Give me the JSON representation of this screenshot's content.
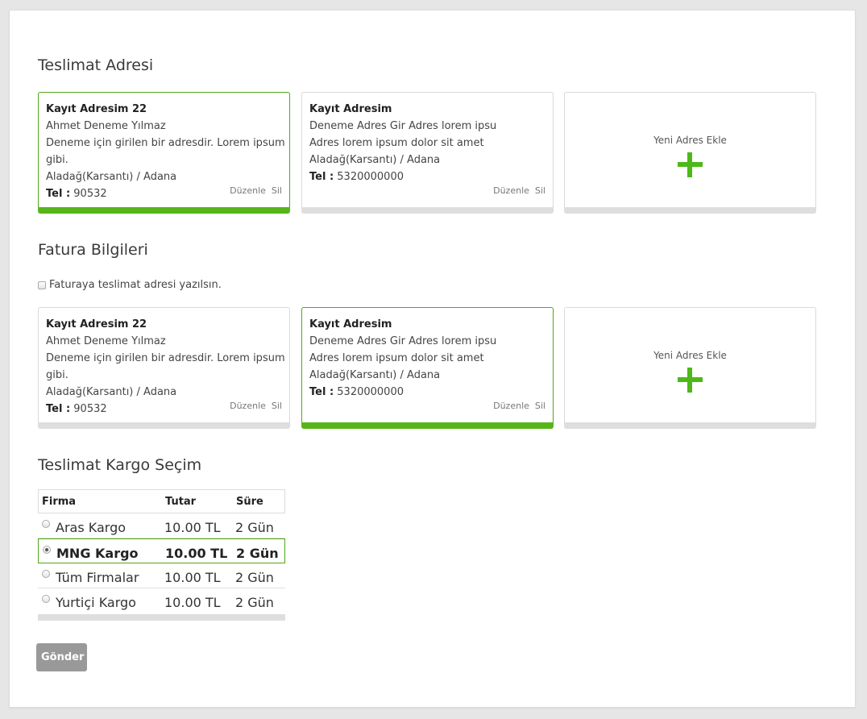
{
  "delivery": {
    "title": "Teslimat Adresi",
    "addresses": [
      {
        "name": "Kayıt Adresim 22",
        "person": "Ahmet Deneme Yılmaz",
        "line": "Deneme için girilen bir adresdir. Lorem ipsum gibi.",
        "city": "Aladağ(Karsantı) / Adana",
        "tel_label": "Tel :",
        "tel": " 90532",
        "edit": "Düzenle",
        "delete": "Sil",
        "selected": true
      },
      {
        "name": "Kayıt Adresim",
        "person": "Deneme Adres Gir Adres lorem ipsu",
        "line": "Adres lorem ipsum dolor sit amet",
        "city": "Aladağ(Karsantı) / Adana",
        "tel_label": "Tel :",
        "tel": " 5320000000",
        "edit": "Düzenle",
        "delete": "Sil",
        "selected": false
      }
    ],
    "add_label": "Yeni Adres Ekle"
  },
  "billing": {
    "title": "Fatura Bilgileri",
    "checkbox_label": "Faturaya teslimat adresi yazılsın.",
    "checkbox_checked": false,
    "addresses": [
      {
        "name": "Kayıt Adresim 22",
        "person": "Ahmet Deneme Yılmaz",
        "line": "Deneme için girilen bir adresdir. Lorem ipsum gibi.",
        "city": "Aladağ(Karsantı) / Adana",
        "tel_label": "Tel :",
        "tel": " 90532",
        "edit": "Düzenle",
        "delete": "Sil",
        "selected": false
      },
      {
        "name": "Kayıt Adresim",
        "person": "Deneme Adres Gir Adres lorem ipsu",
        "line": "Adres lorem ipsum dolor sit amet",
        "city": "Aladağ(Karsantı) / Adana",
        "tel_label": "Tel :",
        "tel": " 5320000000",
        "edit": "Düzenle",
        "delete": "Sil",
        "selected": true
      }
    ],
    "add_label": "Yeni Adres Ekle"
  },
  "cargo": {
    "title": "Teslimat Kargo Seçim",
    "columns": [
      "Firma",
      "Tutar",
      "Süre"
    ],
    "rows": [
      {
        "firma": "Aras Kargo",
        "tutar": "10.00 TL",
        "sure": "2 Gün",
        "selected": false
      },
      {
        "firma": "MNG Kargo",
        "tutar": "10.00 TL",
        "sure": "2 Gün",
        "selected": true
      },
      {
        "firma": "Tüm Firmalar",
        "tutar": "10.00 TL",
        "sure": "2 Gün",
        "selected": false
      },
      {
        "firma": "Yurtiçi Kargo",
        "tutar": "10.00 TL",
        "sure": "2 Gün",
        "selected": false
      }
    ]
  },
  "submit_label": "Gönder",
  "colors": {
    "accent": "#57b51a",
    "button": "#999999"
  }
}
